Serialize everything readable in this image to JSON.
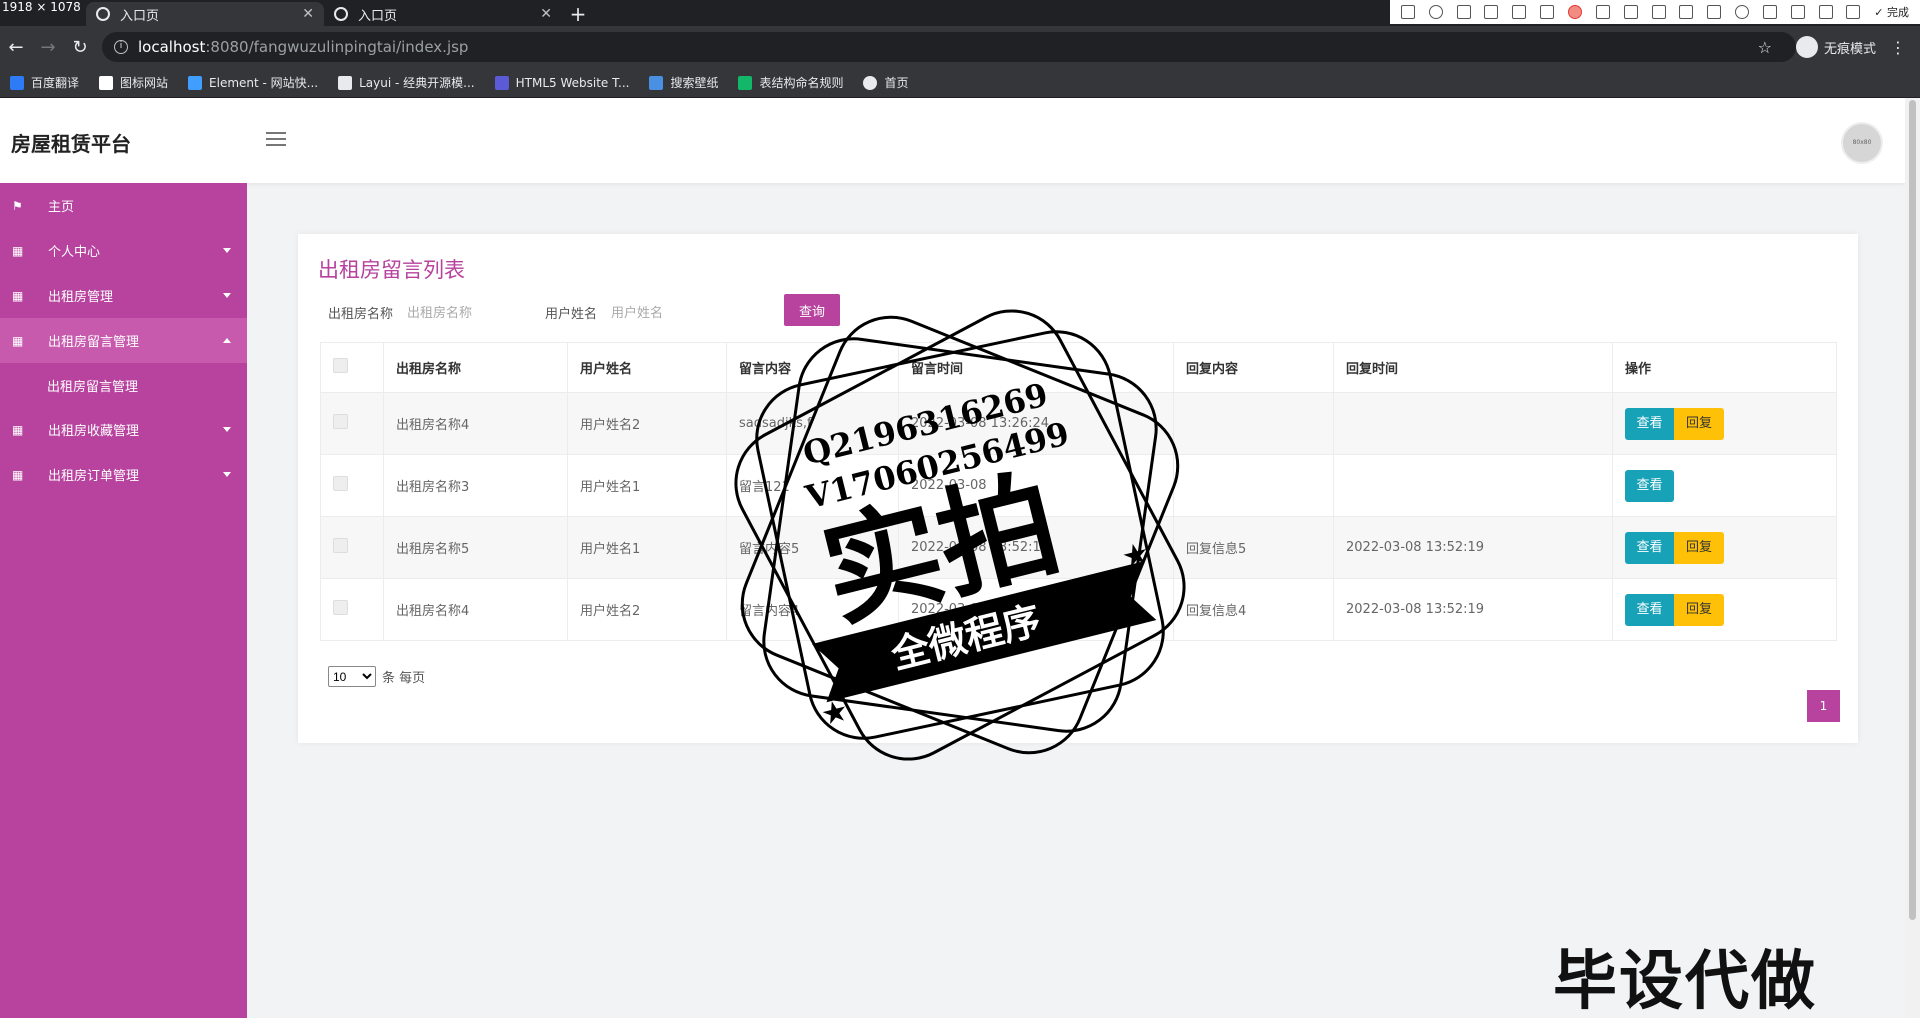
{
  "browser": {
    "resolution_badge": "1918 × 1078",
    "tabs": [
      {
        "title": "入口页"
      },
      {
        "title": "入口页"
      }
    ],
    "new_tab": "+",
    "url_host": "localhost",
    "url_path": ":8080/fangwuzulinpingtai/index.jsp",
    "incognito_label": "无痕模式",
    "toolbar_done": "✓ 完成",
    "bookmarks": [
      {
        "label": "百度翻译",
        "color": "#2d7cf6"
      },
      {
        "label": "图标网站",
        "color": "#ffffff"
      },
      {
        "label": "Element - 网站快...",
        "color": "#409eff"
      },
      {
        "label": "Layui - 经典开源模...",
        "color": "#e8eaed"
      },
      {
        "label": "HTML5 Website T...",
        "color": "#5b5bd6"
      },
      {
        "label": "搜索壁纸",
        "color": "#4a90e2"
      },
      {
        "label": "表结构命名规则",
        "color": "#12b76a"
      },
      {
        "label": "首页",
        "color": "#e8eaed"
      }
    ]
  },
  "app": {
    "brand": "房屋租赁平台",
    "avatar_text": "80x80"
  },
  "sidebar": {
    "items": [
      {
        "label": "主页",
        "icon": "flag-icon",
        "glyph": "⚑"
      },
      {
        "label": "个人中心",
        "icon": "grid-icon",
        "glyph": "▦"
      },
      {
        "label": "出租房管理",
        "icon": "grid-icon",
        "glyph": "▦"
      },
      {
        "label": "出租房留言管理",
        "icon": "grid-icon",
        "glyph": "▦"
      },
      {
        "label": "出租房收藏管理",
        "icon": "grid-icon",
        "glyph": "▦"
      },
      {
        "label": "出租房订单管理",
        "icon": "grid-icon",
        "glyph": "▦"
      }
    ],
    "sub_item": "出租房留言管理"
  },
  "main": {
    "title": "出租房留言列表",
    "filters": {
      "house_label": "出租房名称",
      "house_placeholder": "出租房名称",
      "user_label": "用户姓名",
      "user_placeholder": "用户姓名",
      "search_button": "查询"
    },
    "columns": [
      "出租房名称",
      "用户姓名",
      "留言内容",
      "留言时间",
      "回复内容",
      "回复时间",
      "操作"
    ],
    "rows": [
      {
        "house": "出租房名称4",
        "user": "用户姓名2",
        "message": "sadsadjks,f",
        "time": "2022-03-08 13:26:24",
        "reply": "",
        "reply_time": "",
        "has_reply_btn": true
      },
      {
        "house": "出租房名称3",
        "user": "用户姓名1",
        "message": "留言121",
        "time": "2022-03-08",
        "reply": "",
        "reply_time": "",
        "has_reply_btn": false
      },
      {
        "house": "出租房名称5",
        "user": "用户姓名1",
        "message": "留言内容5",
        "time": "2022-03-08 13:52:19",
        "reply": "回复信息5",
        "reply_time": "2022-03-08 13:52:19",
        "has_reply_btn": true
      },
      {
        "house": "出租房名称4",
        "user": "用户姓名2",
        "message": "留言内容4",
        "time": "2022-03-08 13:52:19",
        "reply": "回复信息4",
        "reply_time": "2022-03-08 13:52:19",
        "has_reply_btn": true
      }
    ],
    "view_label": "查看",
    "reply_label": "回复",
    "page_size": "10",
    "page_size_suffix": "条 每页",
    "current_page": "1"
  },
  "overlay": {
    "stamp_line1": "Q2196316269",
    "stamp_line2": "V17060256499",
    "stamp_big": "实拍",
    "stamp_ribbon": "全微程序",
    "corner_text": "毕设代做"
  }
}
